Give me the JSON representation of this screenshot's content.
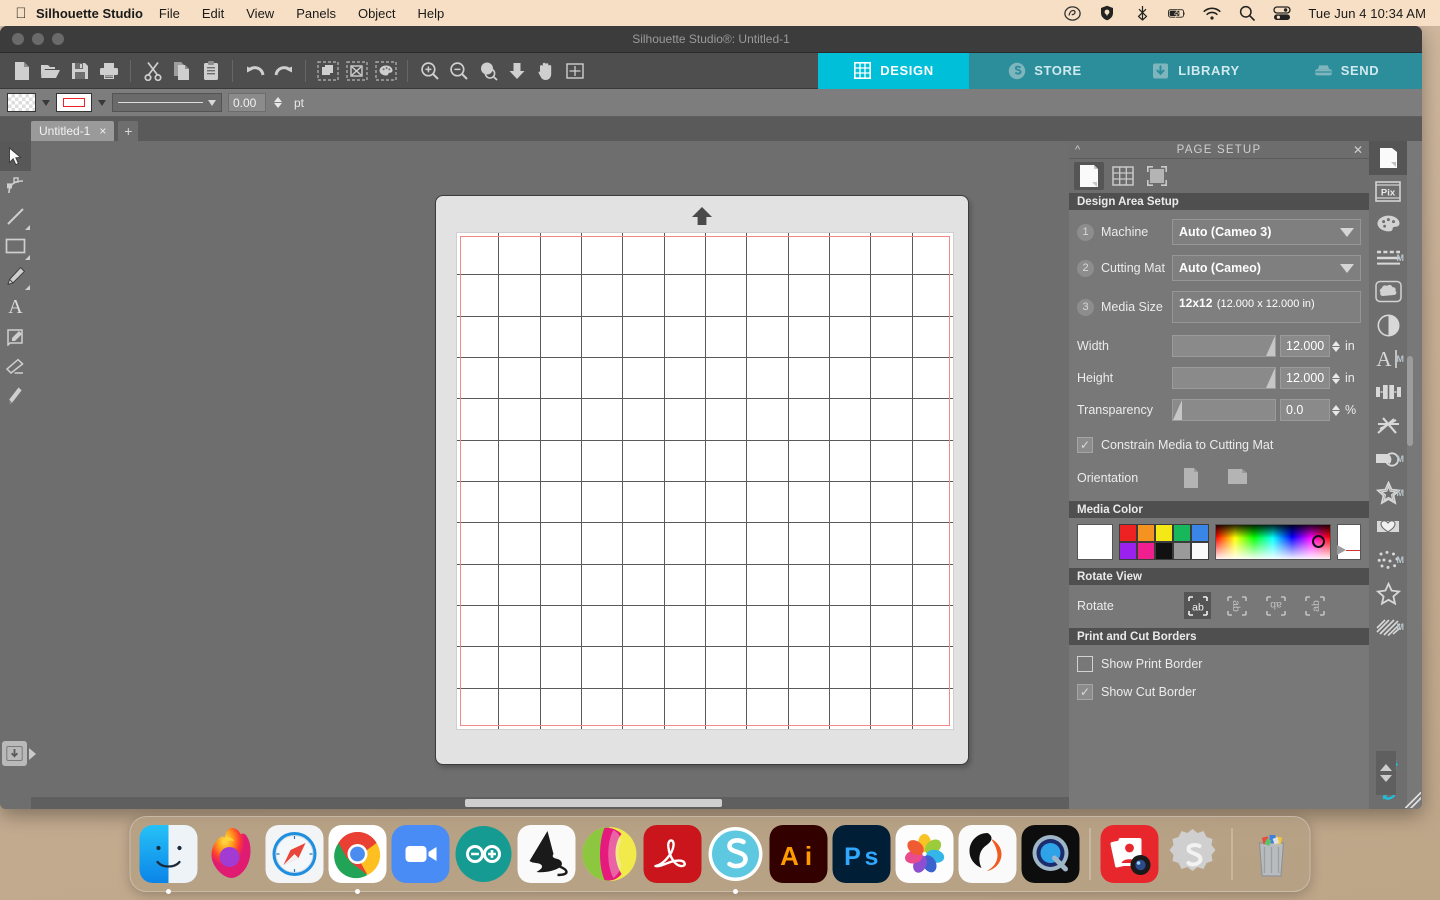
{
  "menubar": {
    "apple_icon": "apple-logo",
    "app_name": "Silhouette Studio",
    "items": [
      "File",
      "Edit",
      "View",
      "Panels",
      "Object",
      "Help"
    ],
    "status_icons": [
      "creative-cloud-icon",
      "shield-icon",
      "bluetooth-icon",
      "battery-charging-icon",
      "wifi-icon",
      "search-icon",
      "control-center-icon"
    ],
    "clock": "Tue Jun 4  10:34 AM"
  },
  "window": {
    "title": "Silhouette Studio®: Untitled-1"
  },
  "toolbar": {
    "file_group": [
      "new-document-icon",
      "open-folder-icon",
      "save-icon",
      "print-icon"
    ],
    "edit_group": [
      "cut-scissors-icon",
      "copy-icon",
      "paste-icon"
    ],
    "history_group": [
      "undo-icon",
      "redo-icon"
    ],
    "select_group": [
      "select-all-icon",
      "deselect-all-icon",
      "select-by-color-icon"
    ],
    "view_group": [
      "zoom-in-icon",
      "zoom-out-icon",
      "zoom-selection-icon",
      "fit-to-page-icon",
      "pan-hand-icon",
      "fit-window-icon"
    ]
  },
  "mode_tabs": [
    {
      "label": "DESIGN",
      "icon": "design-grid-icon",
      "active": true
    },
    {
      "label": "STORE",
      "icon": "store-icon",
      "active": false
    },
    {
      "label": "LIBRARY",
      "icon": "library-folder-icon",
      "active": false
    },
    {
      "label": "SEND",
      "icon": "send-cutter-icon",
      "active": false
    }
  ],
  "style_bar": {
    "fill_swatch": "transparent-checker",
    "line_swatch": "red-outline",
    "line_style": "solid-line",
    "line_weight": "0.00",
    "line_weight_unit": "pt"
  },
  "doc_tabs": {
    "tab_label": "Untitled-1",
    "close_label": "×",
    "add_label": "+"
  },
  "left_tools": [
    {
      "name": "select-tool",
      "icon": "arrow-cursor-icon",
      "active": true,
      "submenu": false
    },
    {
      "name": "edit-points-tool",
      "icon": "node-edit-icon",
      "active": false,
      "submenu": false
    },
    {
      "name": "line-tool",
      "icon": "line-icon",
      "active": false,
      "submenu": true
    },
    {
      "name": "rectangle-tool",
      "icon": "rectangle-icon",
      "active": false,
      "submenu": true
    },
    {
      "name": "draw-tool",
      "icon": "pencil-icon",
      "active": false,
      "submenu": true
    },
    {
      "name": "text-tool",
      "icon": "text-a-icon",
      "active": false,
      "submenu": false
    },
    {
      "name": "notes-tool",
      "icon": "note-pencil-icon",
      "active": false,
      "submenu": false
    },
    {
      "name": "eraser-tool",
      "icon": "eraser-icon",
      "active": false,
      "submenu": false
    },
    {
      "name": "knife-tool",
      "icon": "knife-icon",
      "active": false,
      "submenu": false
    }
  ],
  "canvas": {
    "mat_arrow": "mat-direction-arrow",
    "grid_columns": 12,
    "grid_rows": 12,
    "cut_border_color": "#f08a8a",
    "library_tab_icon": "library-drawer-icon"
  },
  "panel": {
    "title": "PAGE SETUP",
    "collapse_icon": "chevron-up-icon",
    "close_icon": "close-icon",
    "tabs": [
      {
        "name": "page-tab",
        "icon": "page-icon",
        "active": true
      },
      {
        "name": "grid-tab",
        "icon": "grid-icon",
        "active": false
      },
      {
        "name": "registration-tab",
        "icon": "registration-marks-icon",
        "active": false
      }
    ],
    "design_area": {
      "section_title": "Design Area Setup",
      "machine": {
        "step": "1",
        "label": "Machine",
        "value": "Auto (Cameo 3)"
      },
      "cutting_mat": {
        "step": "2",
        "label": "Cutting Mat",
        "value": "Auto (Cameo)"
      },
      "media_size": {
        "step": "3",
        "label": "Media Size",
        "value_line1": "12x12",
        "value_line2": "(12.000 x 12.000 in)"
      },
      "width": {
        "label": "Width",
        "value": "12.000",
        "unit": "in"
      },
      "height": {
        "label": "Height",
        "value": "12.000",
        "unit": "in"
      },
      "transparency": {
        "label": "Transparency",
        "value": "0.0",
        "unit": "%"
      },
      "constrain": {
        "label": "Constrain Media to Cutting Mat",
        "checked": true,
        "check_glyph": "✓"
      },
      "orientation": {
        "label": "Orientation",
        "portrait_icon": "page-portrait-icon",
        "landscape_icon": "page-landscape-icon"
      }
    },
    "media_color": {
      "section_title": "Media Color",
      "current": "#ffffff",
      "swatches": [
        "#ee2222",
        "#f59320",
        "#f5e817",
        "#17b85c",
        "#3a85e8",
        "#9b22ee",
        "#ef1f8f",
        "#111111",
        "#9a9a9a",
        "#fafafa"
      ]
    },
    "rotate_view": {
      "section_title": "Rotate View",
      "label": "Rotate",
      "buttons": [
        {
          "name": "rotate-0",
          "glyph": "ab",
          "rot": 0,
          "active": true
        },
        {
          "name": "rotate-90",
          "glyph": "ab",
          "rot": 90,
          "active": false
        },
        {
          "name": "rotate-180",
          "glyph": "ab",
          "rot": 180,
          "active": false
        },
        {
          "name": "rotate-270",
          "glyph": "ab",
          "rot": 270,
          "active": false
        }
      ]
    },
    "borders": {
      "section_title": "Print and Cut Borders",
      "print_border": {
        "label": "Show Print Border",
        "checked": false
      },
      "cut_border": {
        "label": "Show Cut Border",
        "checked": true,
        "check_glyph": "✓"
      }
    }
  },
  "right_rail": {
    "items": [
      {
        "name": "page-setup-panel",
        "icon": "page-icon",
        "active": true,
        "badge": ""
      },
      {
        "name": "pixscan-panel",
        "icon": "pixscan-icon",
        "active": false,
        "badge": ""
      },
      {
        "name": "fill-color-panel",
        "icon": "palette-icon",
        "active": false,
        "badge": ""
      },
      {
        "name": "line-style-panel",
        "icon": "line-style-icon",
        "active": false,
        "badge": "M"
      },
      {
        "name": "trace-panel",
        "icon": "trace-icon",
        "active": false,
        "badge": ""
      },
      {
        "name": "modify-panel",
        "icon": "contrast-circle-icon",
        "active": false,
        "badge": ""
      },
      {
        "name": "text-style-panel",
        "icon": "text-cursor-icon",
        "active": false,
        "badge": "M"
      },
      {
        "name": "align-panel",
        "icon": "align-icon",
        "active": false,
        "badge": ""
      },
      {
        "name": "knife-panel",
        "icon": "knife-blades-icon",
        "active": false,
        "badge": ""
      },
      {
        "name": "offset-panel",
        "icon": "offset-shapes-icon",
        "active": false,
        "badge": "M"
      },
      {
        "name": "rhinestone-panel",
        "icon": "star-rhinestone-icon",
        "active": false,
        "badge": ""
      },
      {
        "name": "sticker-panel",
        "icon": "sticker-heart-icon",
        "active": false,
        "badge": ""
      },
      {
        "name": "stipple-panel",
        "icon": "stipple-dots-icon",
        "active": false,
        "badge": "M"
      },
      {
        "name": "shape-panel",
        "icon": "star-outline-icon",
        "active": false,
        "badge": ""
      },
      {
        "name": "sketch-panel",
        "icon": "sketch-hatch-icon",
        "active": false,
        "badge": "M"
      }
    ],
    "bottom": [
      {
        "name": "preferences-button",
        "icon": "gear-icon",
        "color": "#19c3e0"
      },
      {
        "name": "sync-button",
        "icon": "sync-refresh-icon",
        "color": "#19c3e0"
      }
    ]
  },
  "dock": {
    "items": [
      {
        "name": "finder",
        "icon": "finder-icon",
        "running": true
      },
      {
        "name": "firefox",
        "icon": "firefox-icon",
        "running": false
      },
      {
        "name": "safari",
        "icon": "safari-icon",
        "running": false
      },
      {
        "name": "chrome",
        "icon": "chrome-icon",
        "running": true
      },
      {
        "name": "zoom",
        "icon": "zoom-video-icon",
        "running": false
      },
      {
        "name": "arduino",
        "icon": "arduino-icon",
        "running": false
      },
      {
        "name": "inkscape",
        "icon": "inkscape-icon",
        "running": false
      },
      {
        "name": "krita",
        "icon": "krita-ball-icon",
        "running": false
      },
      {
        "name": "acrobat",
        "icon": "acrobat-icon",
        "running": false
      },
      {
        "name": "silhouette-studio",
        "icon": "silhouette-s-icon",
        "running": true
      },
      {
        "name": "illustrator",
        "icon": "illustrator-icon",
        "running": false
      },
      {
        "name": "photoshop",
        "icon": "photoshop-icon",
        "running": false
      },
      {
        "name": "photos",
        "icon": "photos-icon",
        "running": false
      },
      {
        "name": "handbrake",
        "icon": "handbrake-icon",
        "running": false
      },
      {
        "name": "quicktime",
        "icon": "quicktime-icon",
        "running": false
      },
      {
        "name": "screenshot-app",
        "icon": "screenshot-icon",
        "running": false
      },
      {
        "name": "silhouette-gear",
        "icon": "silhouette-gear-icon",
        "running": false
      },
      {
        "name": "trash",
        "icon": "trash-icon",
        "running": false
      }
    ]
  }
}
